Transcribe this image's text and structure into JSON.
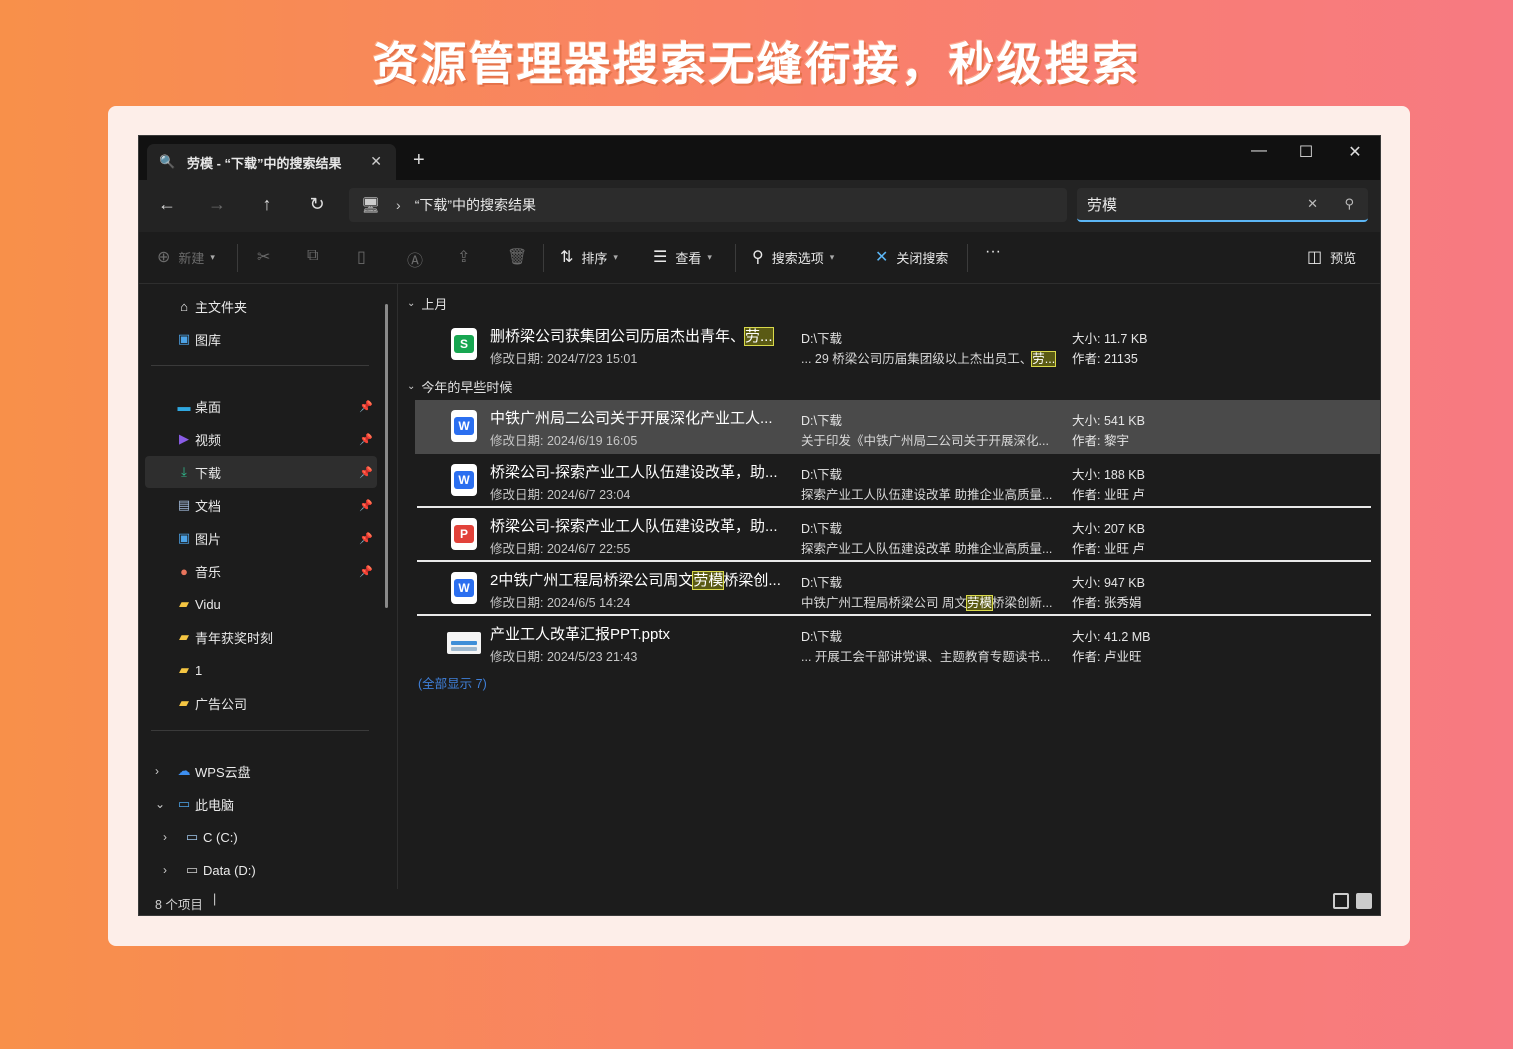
{
  "headline": "资源管理器搜索无缝衔接，秒级搜索",
  "window": {
    "tab_title": "劳模 - “下载”中的搜索结果",
    "tab_close": "✕",
    "new_tab": "+",
    "min": "—",
    "max": "☐",
    "close": "✕"
  },
  "nav": {
    "back": "←",
    "forward": "→",
    "up": "↑",
    "refresh": "↻",
    "address": "“下载”中的搜索结果",
    "search_value": "劳模"
  },
  "toolbar": {
    "new": "新建",
    "sort": "排序",
    "view": "查看",
    "search_options": "搜索选项",
    "close_search": "关闭搜索",
    "more": "···",
    "preview": "预览"
  },
  "sidebar": {
    "items": [
      {
        "label": "主文件夹",
        "icon": "home-icon"
      },
      {
        "label": "图库",
        "icon": "gallery-icon"
      },
      {
        "label": "桌面",
        "icon": "desktop-icon"
      },
      {
        "label": "视频",
        "icon": "video-icon"
      },
      {
        "label": "下载",
        "icon": "download-icon"
      },
      {
        "label": "文档",
        "icon": "document-icon"
      },
      {
        "label": "图片",
        "icon": "picture-icon"
      },
      {
        "label": "音乐",
        "icon": "music-icon"
      },
      {
        "label": "Vidu",
        "icon": "folder-icon"
      },
      {
        "label": "青年获奖时刻",
        "icon": "folder-icon"
      },
      {
        "label": "1",
        "icon": "folder-icon"
      },
      {
        "label": "广告公司",
        "icon": "folder-icon"
      },
      {
        "label": "WPS云盘",
        "icon": "cloud-icon"
      },
      {
        "label": "此电脑",
        "icon": "computer-icon"
      },
      {
        "label": "C (C:)",
        "icon": "drive-icon"
      },
      {
        "label": "Data (D:)",
        "icon": "drive-icon"
      }
    ]
  },
  "groups": {
    "last_month": "上月",
    "earlier_this_year": "今年的早些时候"
  },
  "files": [
    {
      "name_pre": "删桥梁公司获集团公司历届杰出青年、",
      "name_hl": "劳...",
      "name_post": "",
      "date": "修改日期: 2024/7/23 15:01",
      "location": "D:\\下载",
      "snip_pre": "... 29 桥梁公司历届集团级以上杰出员工、",
      "snip_hl": "劳...",
      "snip_post": "",
      "size": "大小: 11.7 KB",
      "author": "作者: 21135",
      "type": "xls"
    },
    {
      "name_pre": "中铁广州局二公司关于开展深化产业工人...",
      "name_hl": "",
      "name_post": "",
      "date": "修改日期: 2024/6/19 16:05",
      "location": "D:\\下载",
      "snip_pre": "关于印发《中铁广州局二公司关于开展深化...",
      "snip_hl": "",
      "snip_post": "",
      "size": "大小: 541 KB",
      "author": "作者: 黎宇",
      "type": "doc"
    },
    {
      "name_pre": "桥梁公司-探索产业工人队伍建设改革，助...",
      "name_hl": "",
      "name_post": "",
      "date": "修改日期: 2024/6/7 23:04",
      "location": "D:\\下载",
      "snip_pre": "探索产业工人队伍建设改革 助推企业高质量...",
      "snip_hl": "",
      "snip_post": "",
      "size": "大小: 188 KB",
      "author": "作者: 业旺 卢",
      "type": "doc"
    },
    {
      "name_pre": "桥梁公司-探索产业工人队伍建设改革，助...",
      "name_hl": "",
      "name_post": "",
      "date": "修改日期: 2024/6/7 22:55",
      "location": "D:\\下载",
      "snip_pre": "探索产业工人队伍建设改革 助推企业高质量...",
      "snip_hl": "",
      "snip_post": "",
      "size": "大小: 207 KB",
      "author": "作者: 业旺 卢",
      "type": "pdf"
    },
    {
      "name_pre": "2中铁广州工程局桥梁公司周文",
      "name_hl": "劳模",
      "name_post": "桥梁创...",
      "date": "修改日期: 2024/6/5 14:24",
      "location": "D:\\下载",
      "snip_pre": "中铁广州工程局桥梁公司 周文",
      "snip_hl": "劳模",
      "snip_post": "桥梁创新...",
      "size": "大小: 947 KB",
      "author": "作者: 张秀娟",
      "type": "doc"
    },
    {
      "name_pre": "产业工人改革汇报PPT.pptx",
      "name_hl": "",
      "name_post": "",
      "date": "修改日期: 2024/5/23 21:43",
      "location": "D:\\下载",
      "snip_pre": "... 开展工会干部讲党课、主题教育专题读书...",
      "snip_hl": "",
      "snip_post": "",
      "size": "大小: 41.2 MB",
      "author": "作者: 卢业旺",
      "type": "ppt"
    }
  ],
  "show_all": "(全部显示 7)",
  "status": {
    "count": "8 个项目",
    "cursor": "|"
  },
  "colors": {
    "accent": "#5cb6f5",
    "highlight": "#d9d94a",
    "link": "#3f7fd8"
  }
}
